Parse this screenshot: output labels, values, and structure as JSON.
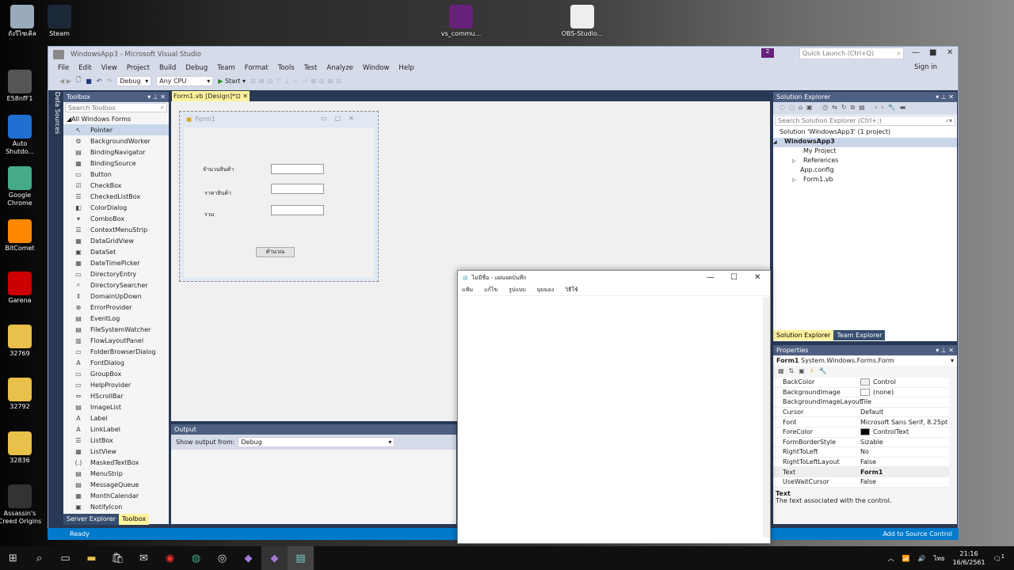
{
  "desktop": {
    "icons": [
      "ถังรีไซเคิล",
      "Steam",
      "vs_commu...",
      "OBS-Studio...",
      "E58nfF1",
      "Auto Shutdo...",
      "Google Chrome",
      "BitComet",
      "Garena",
      "32769",
      "32792",
      "32836",
      "Assassin's Creed Origins"
    ]
  },
  "vs": {
    "title": "WindowsApp3 - Microsoft Visual Studio",
    "quick_launch": "Quick Launch (Ctrl+Q)",
    "notification_count": "2",
    "sign_in": "Sign in",
    "menu": [
      "File",
      "Edit",
      "View",
      "Project",
      "Build",
      "Debug",
      "Team",
      "Format",
      "Tools",
      "Test",
      "Analyze",
      "Window",
      "Help"
    ],
    "toolbar": {
      "config": "Debug",
      "platform": "Any CPU",
      "start": "Start"
    },
    "data_sources_tab": "Data Sources",
    "toolbox": {
      "title": "Toolbox",
      "search_placeholder": "Search Toolbox",
      "group": "All Windows Forms",
      "items": [
        "Pointer",
        "BackgroundWorker",
        "BindingNavigator",
        "BindingSource",
        "Button",
        "CheckBox",
        "CheckedListBox",
        "ColorDialog",
        "ComboBox",
        "ContextMenuStrip",
        "DataGridView",
        "DataSet",
        "DateTimePicker",
        "DirectoryEntry",
        "DirectorySearcher",
        "DomainUpDown",
        "ErrorProvider",
        "EventLog",
        "FileSystemWatcher",
        "FlowLayoutPanel",
        "FolderBrowserDialog",
        "FontDialog",
        "GroupBox",
        "HelpProvider",
        "HScrollBar",
        "ImageList",
        "Label",
        "LinkLabel",
        "ListBox",
        "ListView",
        "MaskedTextBox",
        "MenuStrip",
        "MessageQueue",
        "MonthCalendar",
        "NotifyIcon"
      ],
      "bottom_tabs": [
        "Server Explorer",
        "Toolbox"
      ]
    },
    "doc_tab": "Form1.vb [Design]*",
    "form": {
      "title": "Form1",
      "labels": [
        "จำนวนสินค้า",
        "ราคาสินค้า",
        "รวม"
      ],
      "button": "คำนวณ"
    },
    "output": {
      "title": "Output",
      "show_from_label": "Show output from:",
      "show_from_value": "Debug"
    },
    "solution_explorer": {
      "title": "Solution Explorer",
      "search_placeholder": "Search Solution Explorer (Ctrl+;)",
      "tree": [
        "Solution 'WindowsApp3' (1 project)",
        "WindowsApp3",
        "My Project",
        "References",
        "App.config",
        "Form1.vb"
      ],
      "tabs": [
        "Solution Explorer",
        "Team Explorer"
      ]
    },
    "properties": {
      "title": "Properties",
      "object": "Form1",
      "object_type": "System.Windows.Forms.Form",
      "rows": [
        {
          "k": "BackColor",
          "v": "Control",
          "swatch": "#f0f0f0"
        },
        {
          "k": "BackgroundImage",
          "v": "(none)",
          "swatch": "#ffffff"
        },
        {
          "k": "BackgroundImageLayout",
          "v": "Tile"
        },
        {
          "k": "Cursor",
          "v": "Default"
        },
        {
          "k": "Font",
          "v": "Microsoft Sans Serif, 8.25pt"
        },
        {
          "k": "ForeColor",
          "v": "ControlText",
          "swatch": "#000000"
        },
        {
          "k": "FormBorderStyle",
          "v": "Sizable"
        },
        {
          "k": "RightToLeft",
          "v": "No"
        },
        {
          "k": "RightToLeftLayout",
          "v": "False"
        },
        {
          "k": "Text",
          "v": "Form1"
        },
        {
          "k": "UseWaitCursor",
          "v": "False"
        }
      ],
      "desc_title": "Text",
      "desc": "The text associated with the control."
    },
    "status": {
      "ready": "Ready",
      "source_control": "Add to Source Control"
    }
  },
  "notepad": {
    "title": "ไม่มีชื่อ - แผ่นจดบันทึก",
    "menu": [
      "แฟ้ม",
      "แก้ไข",
      "รูปแบบ",
      "มุมมอง",
      "วิธีใช้"
    ]
  },
  "taskbar": {
    "time": "21:16",
    "date": "16/6/2561",
    "lang": "ไทย",
    "notifications": "1"
  },
  "colors": {
    "accent": "#007acc",
    "vs_dark": "#293955",
    "tab_active": "#fff29d"
  }
}
